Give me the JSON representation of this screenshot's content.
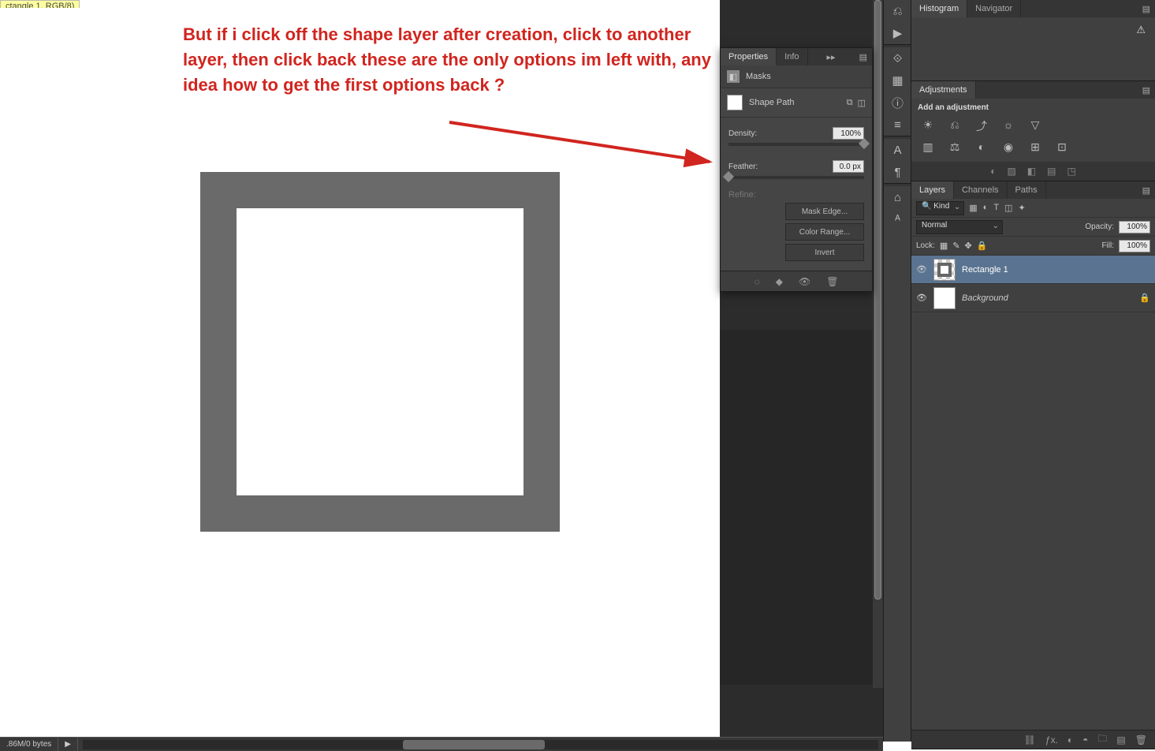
{
  "doc_tab": "ctangle 1, RGB/8)",
  "annotation": "But if i click off the shape layer after creation, click to another layer, then click back these are the only options im left with, any idea how to get the first options back ?",
  "status": {
    "size": ".86M/0 bytes"
  },
  "properties": {
    "tabs": [
      "Properties",
      "Info"
    ],
    "masks_label": "Masks",
    "shape_path_label": "Shape Path",
    "density_label": "Density:",
    "density_value": "100%",
    "feather_label": "Feather:",
    "feather_value": "0.0 px",
    "refine_label": "Refine:",
    "btn_mask_edge": "Mask Edge...",
    "btn_color_range": "Color Range...",
    "btn_invert": "Invert"
  },
  "histogram": {
    "tabs": [
      "Histogram",
      "Navigator"
    ]
  },
  "adjustments": {
    "tab": "Adjustments",
    "header": "Add an adjustment"
  },
  "layers": {
    "tabs": [
      "Layers",
      "Channels",
      "Paths"
    ],
    "kind_label": "Kind",
    "blend_mode": "Normal",
    "opacity_label": "Opacity:",
    "opacity_value": "100%",
    "lock_label": "Lock:",
    "fill_label": "Fill:",
    "fill_value": "100%",
    "items": [
      {
        "name": "Rectangle 1",
        "selected": true,
        "locked": false
      },
      {
        "name": "Background",
        "selected": false,
        "locked": true
      }
    ]
  }
}
